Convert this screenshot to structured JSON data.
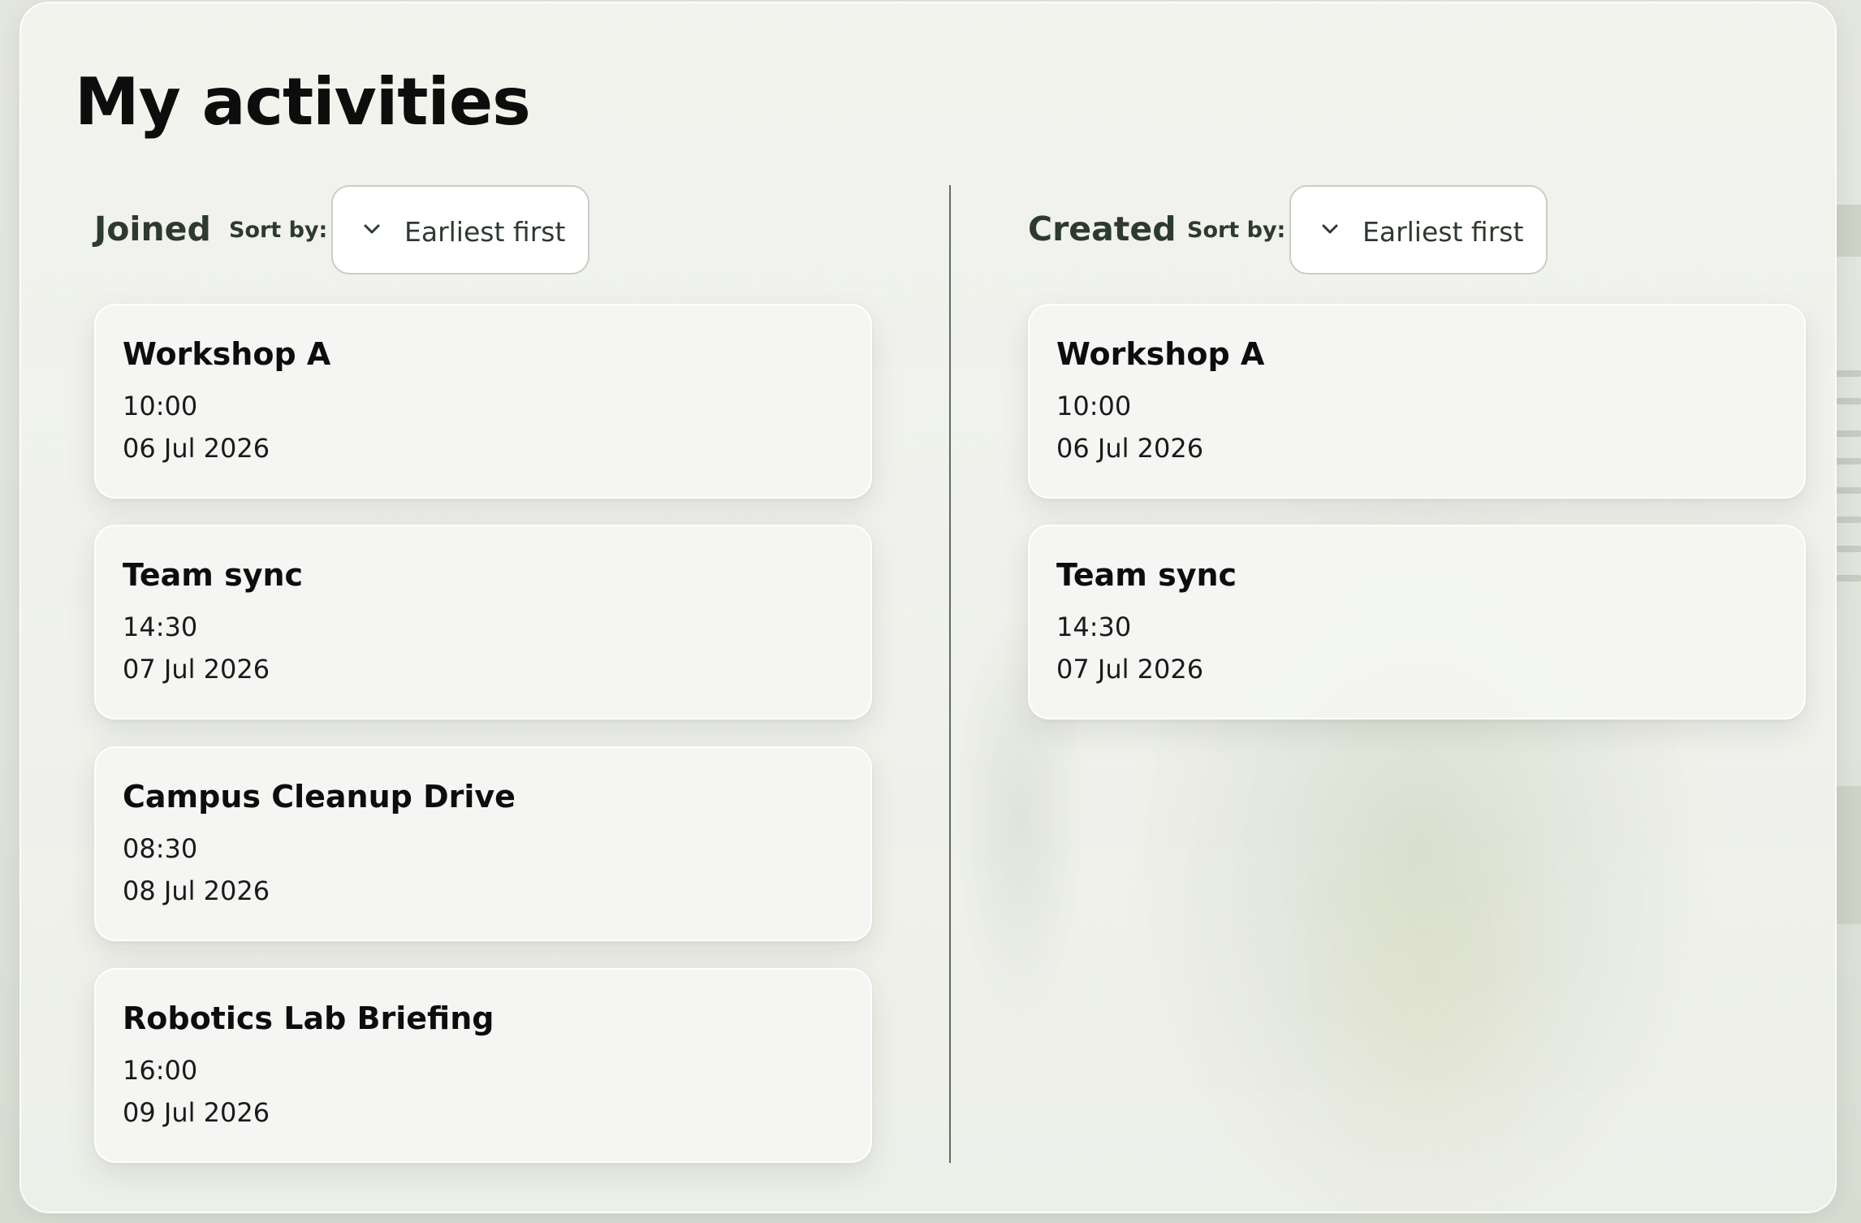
{
  "page": {
    "title": "My activities"
  },
  "joined": {
    "title": "Joined",
    "sort_label": "Sort by:",
    "sort_value": "Earliest first",
    "activities": [
      {
        "name": "Workshop A",
        "time": "10:00",
        "date": "06 Jul 2026"
      },
      {
        "name": "Team sync",
        "time": "14:30",
        "date": "07 Jul 2026"
      },
      {
        "name": "Campus Cleanup Drive",
        "time": "08:30",
        "date": "08 Jul 2026"
      },
      {
        "name": "Robotics Lab Briefing",
        "time": "16:00",
        "date": "09 Jul 2026"
      }
    ]
  },
  "created": {
    "title": "Created",
    "sort_label": "Sort by:",
    "sort_value": "Earliest first",
    "activities": [
      {
        "name": "Workshop A",
        "time": "10:00",
        "date": "06 Jul 2026"
      },
      {
        "name": "Team sync",
        "time": "14:30",
        "date": "07 Jul 2026"
      }
    ]
  },
  "icons": {
    "sort_dropdown": "chevron-down-icon"
  },
  "colors": {
    "heading": "#0d0d0d",
    "section_title": "#2d3a2e",
    "divider": "#5e6b60",
    "card_bg": "#f5f6f2"
  }
}
